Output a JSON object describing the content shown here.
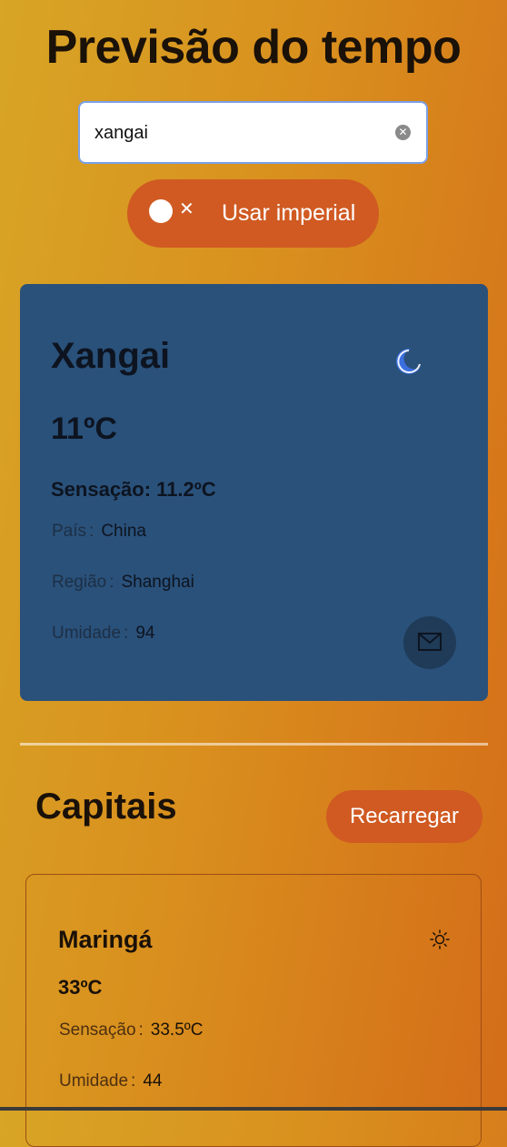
{
  "header": {
    "title": "Previsão do tempo"
  },
  "search": {
    "value": "xangai",
    "clear_icon": "clear-icon"
  },
  "unit_toggle": {
    "label": "Usar imperial",
    "state": "off",
    "icon": "x-icon"
  },
  "current": {
    "city": "Xangai",
    "icon": "moon-icon",
    "temperature": "11ºC",
    "feels_like": "Sensação: 11.2ºC",
    "details": [
      {
        "label": "País",
        "value": "China"
      },
      {
        "label": "Região",
        "value": "Shanghai"
      },
      {
        "label": "Umidade",
        "value": "94"
      }
    ],
    "mail_icon": "mail-icon",
    "colors": {
      "card": "#2a517a",
      "moon": "#3b6fe0"
    }
  },
  "capitals": {
    "title": "Capitais",
    "reload_label": "Recarregar",
    "items": [
      {
        "city": "Maringá",
        "icon": "sun-icon",
        "temperature": "33ºC",
        "feels_like_label": "Sensação",
        "feels_like_value": "33.5ºC",
        "humidity_label": "Umidade",
        "humidity_value": "44"
      }
    ]
  },
  "colors": {
    "accent": "#d05a22",
    "background_start": "#d8a526",
    "background_end": "#d46d19"
  },
  "separator": ":"
}
